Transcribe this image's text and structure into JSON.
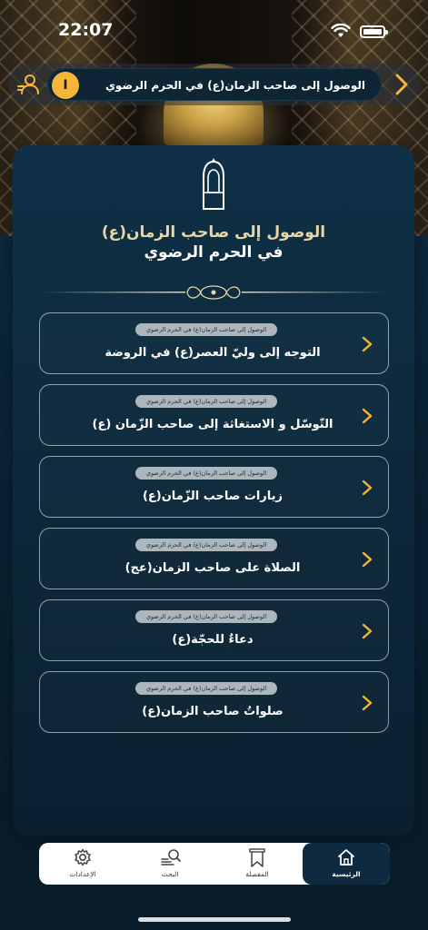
{
  "status_bar": {
    "time": "22:07"
  },
  "header": {
    "title": "الوصول إلى صاحب الزمان(ع) في الحرم الرضوي",
    "badge": "I",
    "icons": {
      "left": "search-person-icon",
      "right": "chevron-right-icon"
    }
  },
  "section": {
    "title_line1": "الوصول إلى صاحب الزمان(ع)",
    "title_line2": "في الحرم الرضوي",
    "emblem_icon": "veiled-figure-icon"
  },
  "menu_items": [
    {
      "tag": "الوصول إلى صاحب الزمان(ع) في الحرم الرضوي",
      "title": "التوجه إلى وليّ العصر(ع) في الروضة"
    },
    {
      "tag": "الوصول إلى صاحب الزمان(ع) في الحرم الرضوي",
      "title": "التّوسّل و الاستغاثة إلى صاحب الزّمان (ع)"
    },
    {
      "tag": "الوصول إلى صاحب الزمان(ع) في الحرم الرضوي",
      "title": "زيارات صاحب الزّمان(ع)"
    },
    {
      "tag": "الوصول إلى صاحب الزمان(ع) في الحرم الرضوي",
      "title": "الصلاة على صاحب الزمان(عج)"
    },
    {
      "tag": "الوصول إلى صاحب الزمان(ع) في الحرم الرضوي",
      "title": "دعاءٌ للحجّة(ع)"
    },
    {
      "tag": "الوصول إلى صاحب الزمان(ع) في الحرم الرضوي",
      "title": "صلواتُ صاحب الزمان(ع)"
    }
  ],
  "tab_bar": {
    "tabs": [
      {
        "label": "الإعدادات",
        "icon": "gear-icon",
        "active": false
      },
      {
        "label": "البحث",
        "icon": "search-list-icon",
        "active": false
      },
      {
        "label": "المفضلة",
        "icon": "bookmark-icon",
        "active": false
      },
      {
        "label": "الرئيسية",
        "icon": "home-icon",
        "active": true
      }
    ]
  },
  "colors": {
    "accent": "#f5b63a",
    "panel": "#0f3047",
    "gold_title": "#e8d7a6",
    "active_tab": "#0d2a40"
  }
}
